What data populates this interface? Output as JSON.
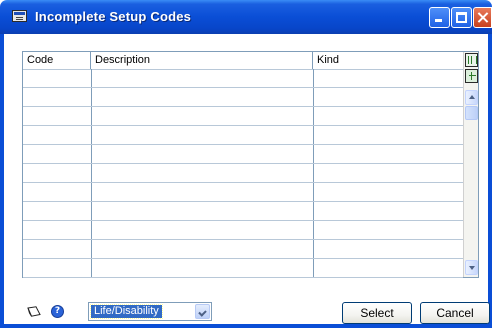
{
  "window": {
    "title": "Incomplete Setup Codes",
    "accent_color": "#0a4ed6",
    "icons": {
      "title": "window-icon",
      "minimize": "minimize-icon",
      "maximize": "maximize-icon",
      "close": "close-icon"
    }
  },
  "grid": {
    "columns": [
      "Code",
      "Description",
      "Kind"
    ],
    "rows": [
      {
        "code": "",
        "description": "",
        "kind": ""
      },
      {
        "code": "",
        "description": "",
        "kind": ""
      },
      {
        "code": "",
        "description": "",
        "kind": ""
      },
      {
        "code": "",
        "description": "",
        "kind": ""
      },
      {
        "code": "",
        "description": "",
        "kind": ""
      },
      {
        "code": "",
        "description": "",
        "kind": ""
      },
      {
        "code": "",
        "description": "",
        "kind": ""
      },
      {
        "code": "",
        "description": "",
        "kind": ""
      },
      {
        "code": "",
        "description": "",
        "kind": ""
      },
      {
        "code": "",
        "description": "",
        "kind": ""
      },
      {
        "code": "",
        "description": "",
        "kind": ""
      }
    ]
  },
  "footer": {
    "filter_selected": "Life/Disability",
    "select_label": "Select",
    "cancel_label": "Cancel",
    "icons": {
      "note": "note-icon",
      "help": "help-icon"
    }
  }
}
